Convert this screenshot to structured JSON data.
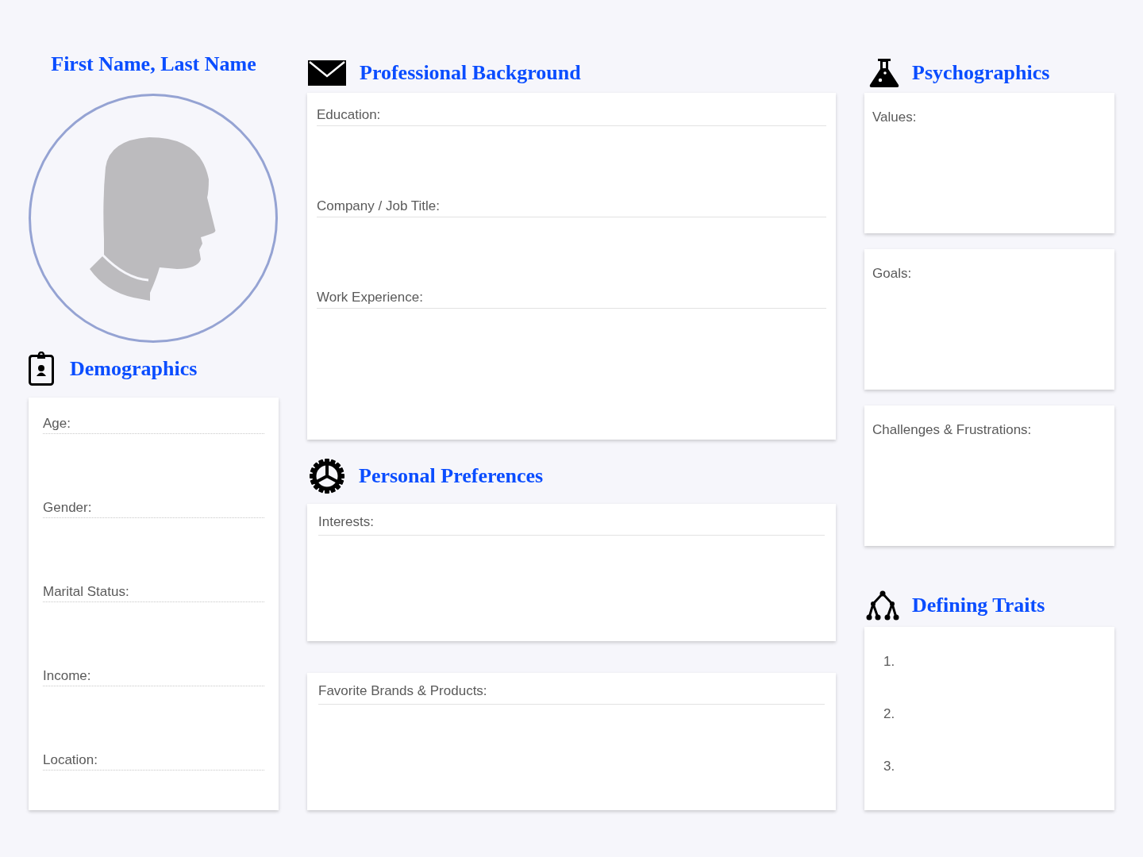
{
  "profile": {
    "name": "First Name, Last Name"
  },
  "demographics": {
    "title": "Demographics",
    "fields": [
      "Age:",
      "Gender:",
      "Marital Status:",
      "Income:",
      "Location:"
    ]
  },
  "professional_background": {
    "title": "Professional Background",
    "fields": [
      "Education:",
      "Company / Job Title:",
      "Work Experience:"
    ]
  },
  "personal_preferences": {
    "title": "Personal Preferences",
    "cards": [
      "Interests:",
      "Favorite Brands & Products:"
    ]
  },
  "psychographics": {
    "title": "Psychographics",
    "cards": [
      "Values:",
      "Goals:",
      "Challenges & Frustrations:"
    ]
  },
  "defining_traits": {
    "title": "Defining Traits",
    "items": [
      "1.",
      "2.",
      "3."
    ]
  }
}
